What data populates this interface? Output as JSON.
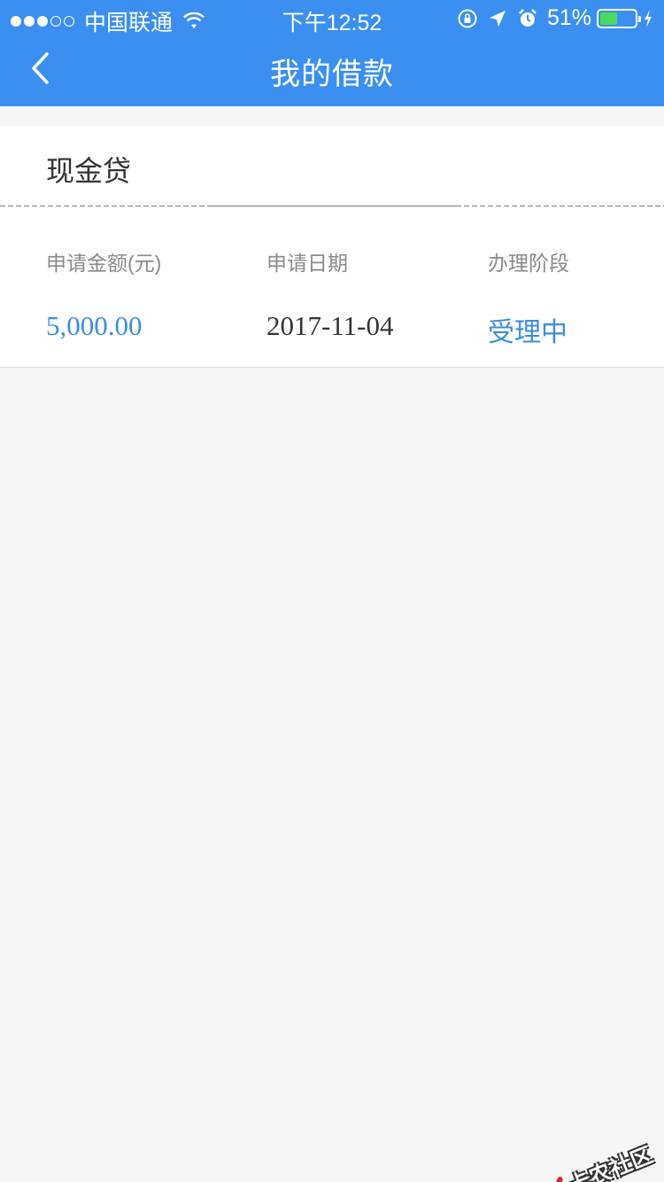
{
  "status_bar": {
    "carrier": "中国联通",
    "time": "下午12:52",
    "battery_percent_text": "51%",
    "battery_level": 0.51,
    "signal_bars_full": 3,
    "signal_bars_total": 5
  },
  "nav": {
    "title": "我的借款",
    "back_icon": "chevron-left-icon"
  },
  "loan_card": {
    "title": "现金贷",
    "columns": {
      "amount_label": "申请金额(元)",
      "date_label": "申请日期",
      "stage_label": "办理阶段"
    },
    "values": {
      "amount": "5,000.00",
      "date": "2017-11-04",
      "stage": "受理中"
    }
  },
  "watermark": {
    "text": "卡农社区"
  },
  "colors": {
    "header_blue": "#3a8ff0",
    "accent_blue": "#3a8ee0",
    "battery_green": "#4cd964",
    "page_bg": "#f6f6f6"
  }
}
